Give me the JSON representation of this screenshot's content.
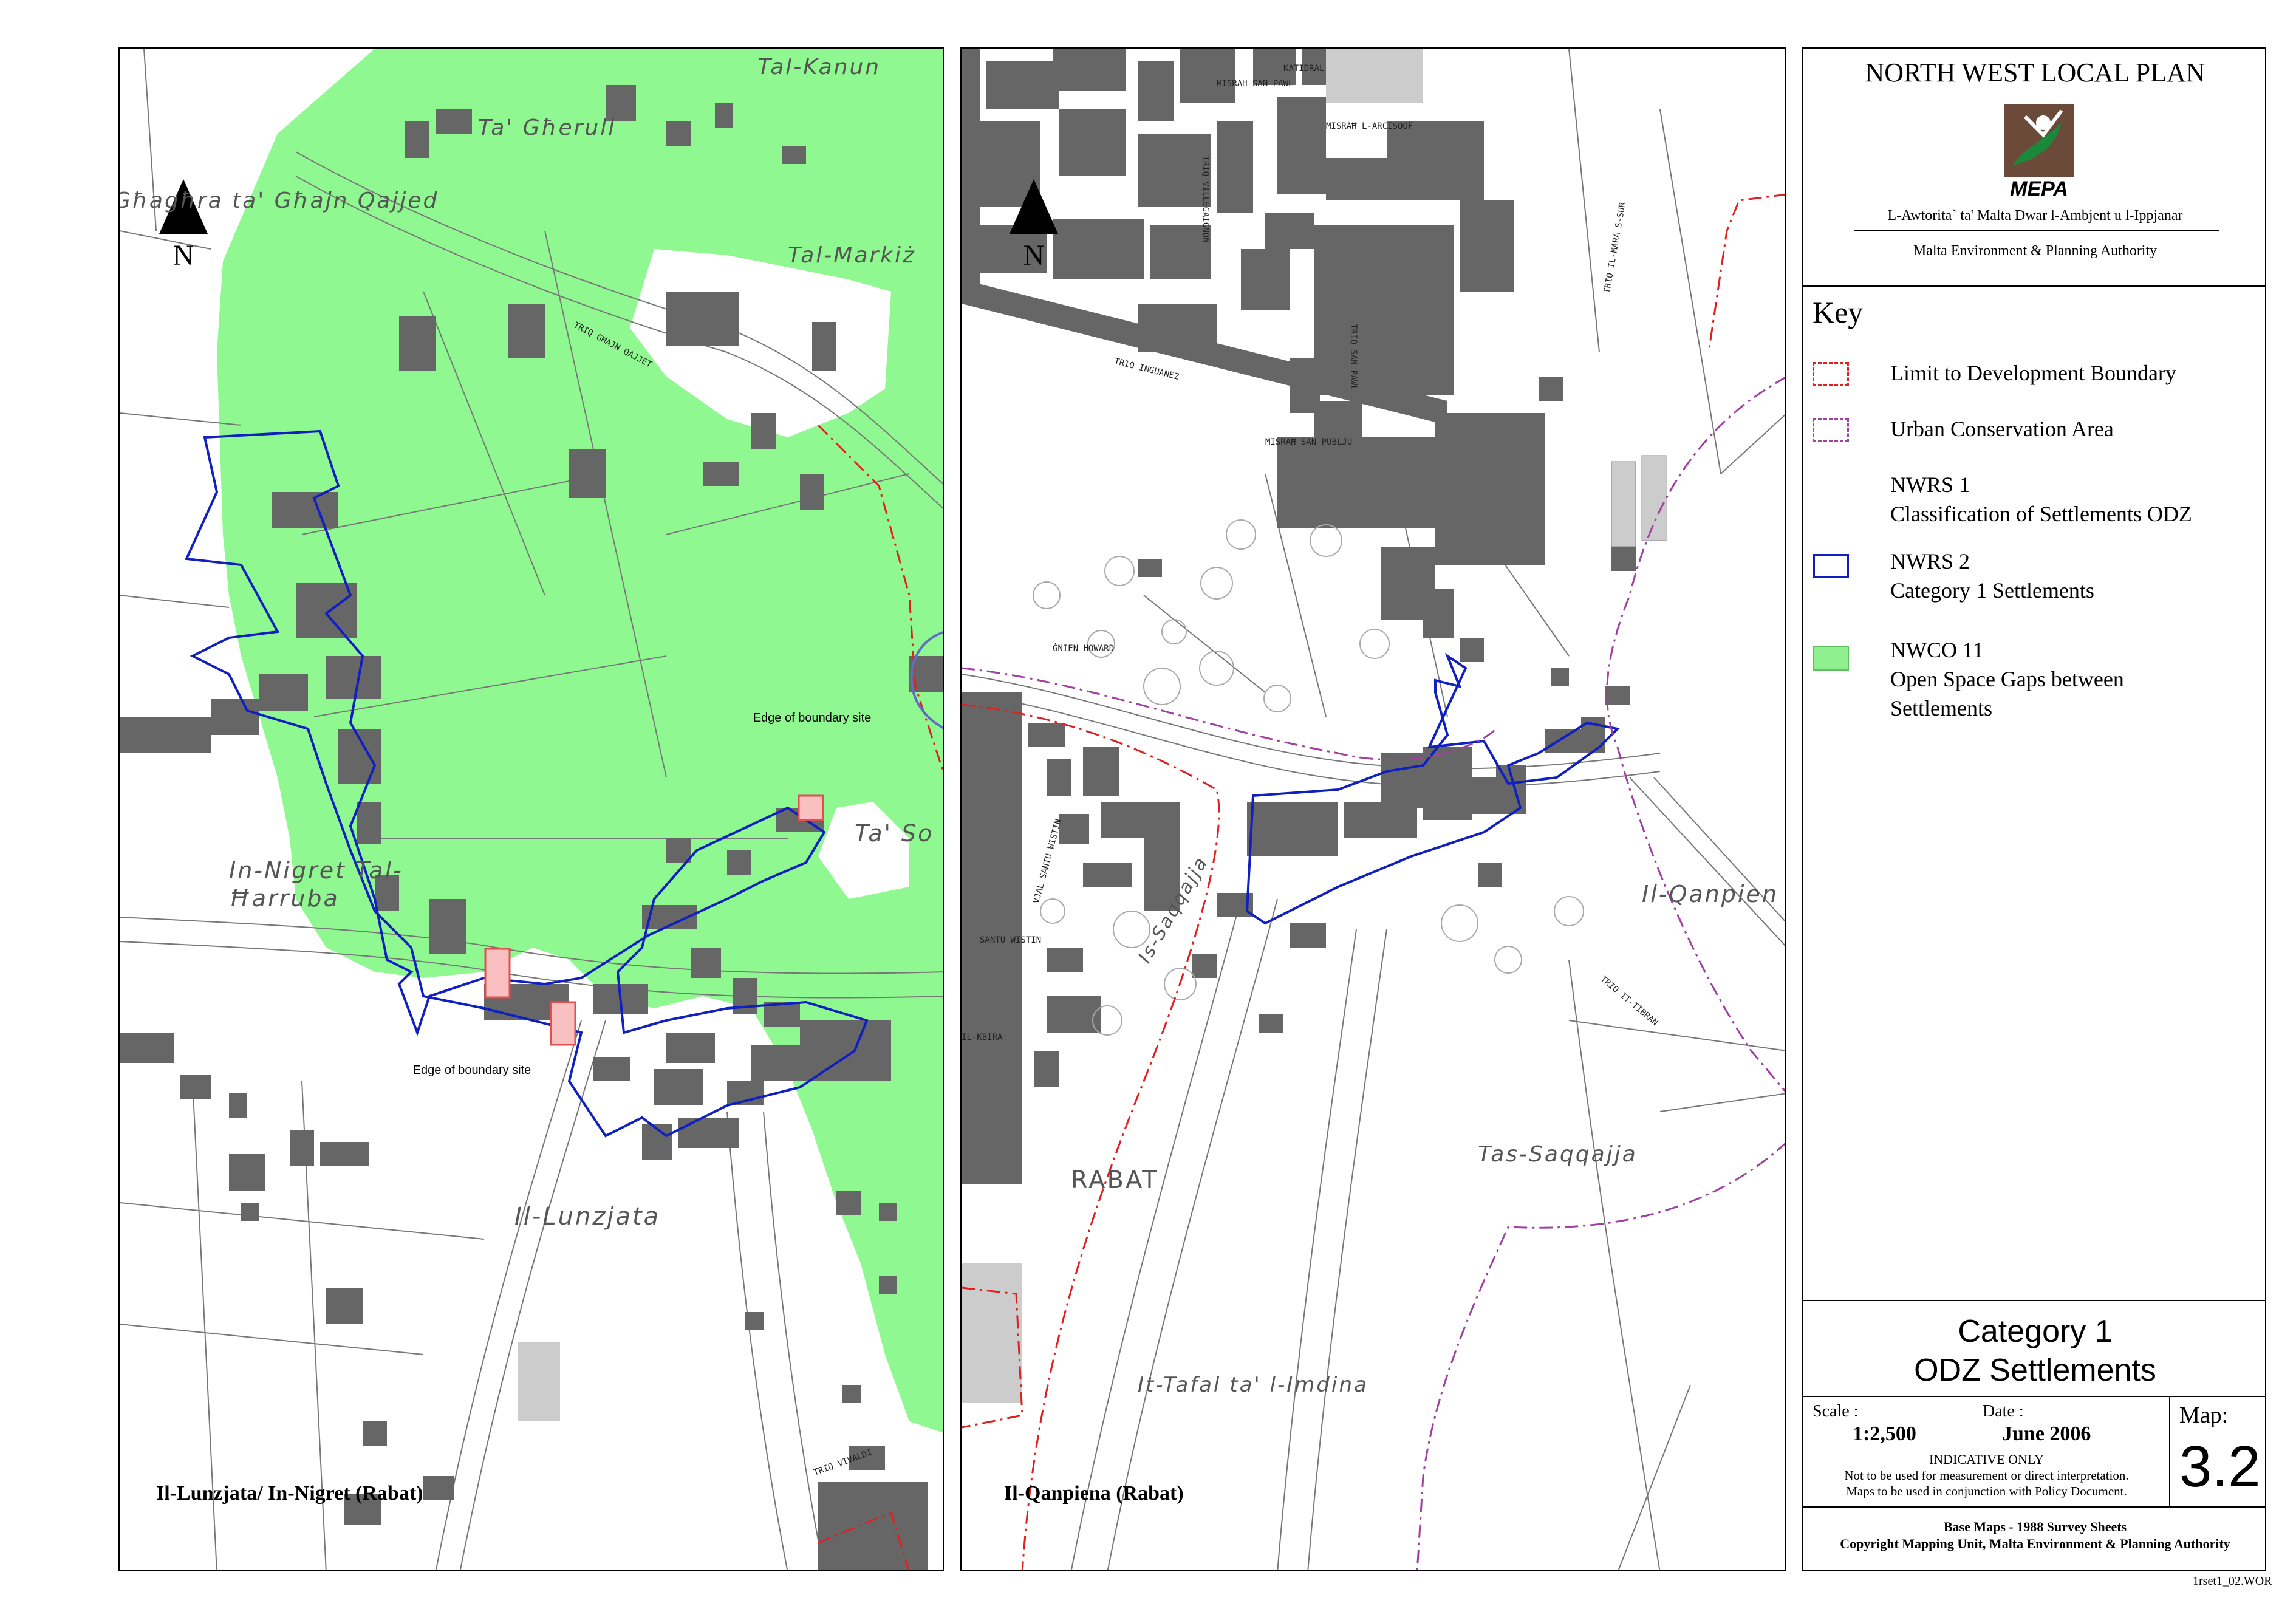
{
  "maps": {
    "left": {
      "label": "Il-Lunzjata/ In-Nigret (Rabat)",
      "north": "N",
      "places": [
        "Għagħra ta' Għajn Qajjed",
        "Tal-Kanun",
        "Ta' Għerull",
        "Tal-Markiż",
        "In-Nigret Tal-Ħarruba",
        "Ta' So",
        "Il-Lunzjata"
      ],
      "streets": [
        "TRIQ GĦAJN QAJJET",
        "TRIQ VIVALDI"
      ],
      "annotations": [
        "Edge of boundary site",
        "Edge of boundary site"
      ]
    },
    "right": {
      "label": "Il-Qanpiena (Rabat)",
      "north": "N",
      "places": [
        "RABAT",
        "Il-Qanpien",
        "Tas-Saqqajja",
        "It-Tafal ta' l-Imdina",
        "Is-Saqqajja"
      ],
      "streets": [
        "MISRAĦ SAN PAWL",
        "KATIDRAL",
        "MISRAĦ L-ARĊISQOF",
        "TRIQ VILLEGAIGNON",
        "TRIQ IL-MARA S-SUR",
        "TRIQ INGUANEZ",
        "TRIQ SAN PAWL",
        "MISRAĦ SAN PUBLJU",
        "ĠNIEN HOWARD",
        "VJAL SANTU WISTIN",
        "SANTU WISTIN",
        "IL-KBIRA",
        "TRIQ IT-TIBRAN"
      ]
    }
  },
  "legend": {
    "title": "NORTH WEST LOCAL PLAN",
    "logo_text": "MEPA",
    "authority_mt": "L-Awtorita` ta' Malta Dwar l-Ambjent u l-Ippjanar",
    "authority_en": "Malta Environment & Planning Authority",
    "key_title": "Key",
    "items": [
      {
        "swatch": "dashed-red",
        "text": "Limit to Development Boundary"
      },
      {
        "swatch": "dashed-purple",
        "text": "Urban Conservation Area"
      },
      {
        "swatch": "none",
        "text": "NWRS 1\nClassification of Settlements ODZ"
      },
      {
        "swatch": "blue-outline",
        "text": "NWRS 2\nCategory 1 Settlements"
      },
      {
        "swatch": "green-fill",
        "text": "NWCO 11\nOpen Space Gaps between\nSettlements"
      }
    ],
    "map_title_line1": "Category 1",
    "map_title_line2": "ODZ Settlements",
    "scale_label": "Scale :",
    "scale_value": "1:2,500",
    "date_label": "Date :",
    "date_value": "June 2006",
    "indicative": "INDICATIVE ONLY",
    "note_line1": "Not to be used for measurement or direct interpretation.",
    "note_line2": "Maps to be used in conjunction with Policy Document.",
    "map_label": "Map:",
    "map_number": "3.2",
    "base_maps": "Base Maps - 1988 Survey Sheets",
    "copyright": "Copyright Mapping Unit, Malta Environment & Planning Authority",
    "file_ref": "1rset1_02.WOR"
  },
  "colors": {
    "open_space": "#90f890",
    "building": "#666666",
    "settlement_outline": "#1020c0",
    "development_limit": "#e02020",
    "conservation_area": "#a040a0",
    "boundary_site": "#e05050"
  }
}
